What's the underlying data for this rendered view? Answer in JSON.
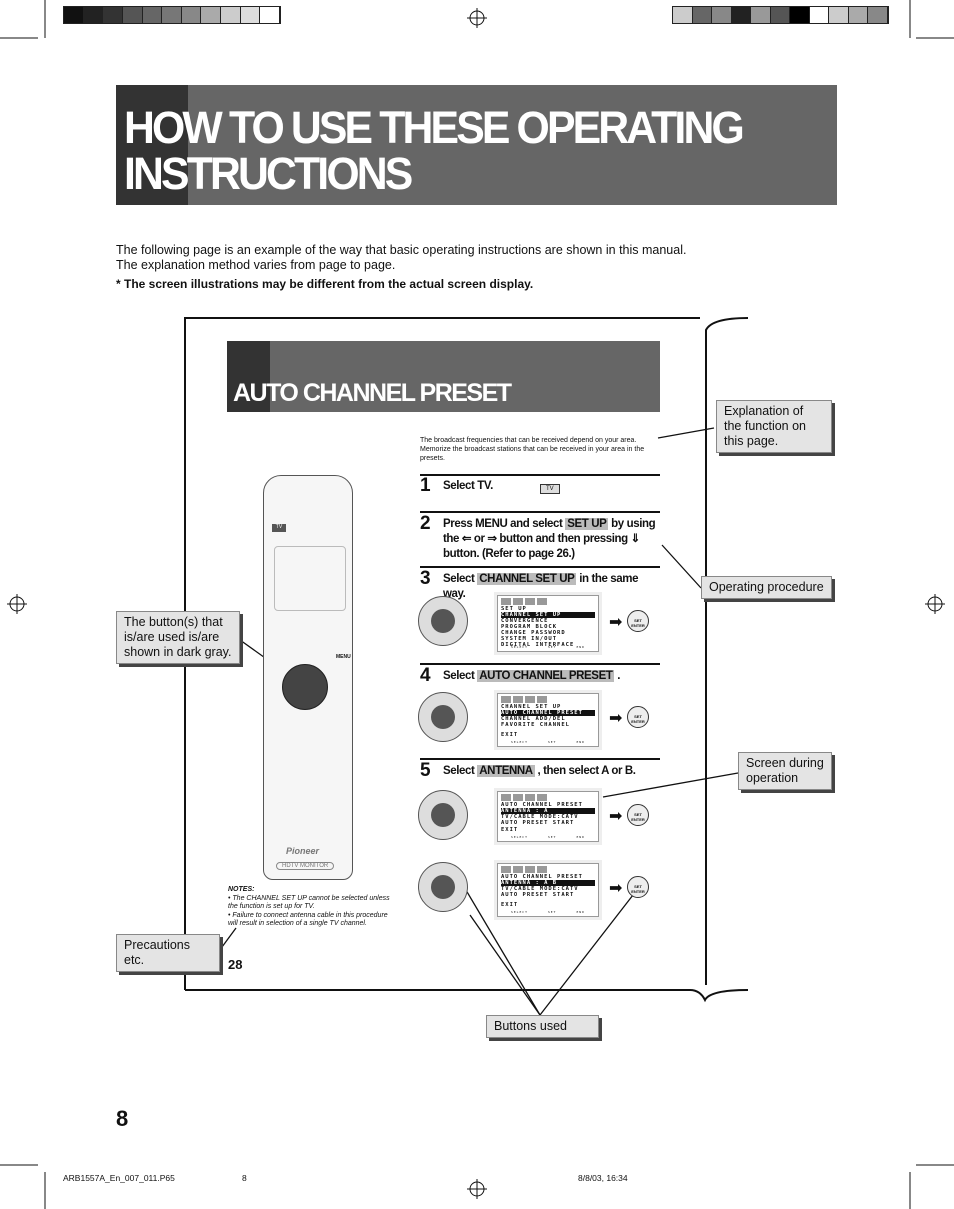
{
  "page": {
    "title": "HOW TO USE THESE OPERATING INSTRUCTIONS",
    "page_number": "8",
    "intro": [
      "The following page is an example of the way that basic operating instructions are shown in this manual.",
      "The explanation method varies from page to page."
    ],
    "note": "* The screen illustrations may be different from the actual screen display."
  },
  "example": {
    "title": "AUTO CHANNEL PRESET",
    "description": "The broadcast frequencies that can be received depend on your area. Memorize the broadcast stations that can be received in your area in the presets.",
    "steps": [
      {
        "num": "1",
        "text": "Select TV.",
        "button": "TV"
      },
      {
        "num": "2",
        "pre": "Press MENU and select ",
        "hl": "SET UP",
        "post": " by using the ⇐ or ⇒ button and then pressing ⇓ button. (Refer to page 26.)"
      },
      {
        "num": "3",
        "pre": "Select ",
        "hl": "CHANNEL SET UP",
        "post": " in the same way."
      },
      {
        "num": "4",
        "pre": "Select ",
        "hl": "AUTO CHANNEL PRESET",
        "post": " ."
      },
      {
        "num": "5",
        "pre": "Select ",
        "hl": "ANTENNA",
        "post": " , then select A or B."
      }
    ],
    "screens": [
      {
        "title": "SET UP",
        "items": [
          "CHANNEL SET UP",
          "CONVERGENCE",
          "PROGRAM BLOCK",
          "CHANGE PASSWORD",
          "SYSTEM IN/OUT",
          "DIGITAL INTERFACE"
        ],
        "selected": 0,
        "exit": ""
      },
      {
        "title": "CHANNEL SET UP",
        "items": [
          "AUTO CHANNEL PRESET",
          "CHANNEL ADD/DEL",
          "FAVORITE CHANNEL"
        ],
        "selected": 0,
        "exit": "EXIT"
      },
      {
        "title": "AUTO CHANNEL PRESET",
        "items": [
          "ANTENNA : A",
          "TV/CABLE MODE:CATV",
          "AUTO PRESET START"
        ],
        "selected": 0,
        "exit": "EXIT"
      },
      {
        "title": "AUTO CHANNEL PRESET",
        "items": [
          "ANTENNA : A B",
          "TV/CABLE MODE:CATV",
          "AUTO PRESET START"
        ],
        "selected": 0,
        "exit": "EXIT"
      }
    ],
    "screen_footer": [
      "SELECT",
      "SET",
      "END"
    ],
    "enter_label": "SET ENTER",
    "notes_title": "NOTES:",
    "notes": [
      "The CHANNEL SET UP cannot be selected unless the function is set up for TV.",
      "Failure to connect antenna cable in this procedure will result in selection of a single TV channel."
    ],
    "page_number": "28",
    "remote": {
      "brand": "Pioneer",
      "model": "HDTV MONITOR",
      "menu": "MENU",
      "tv": "TV"
    }
  },
  "callouts": {
    "explanation": "Explanation of the function on this page.",
    "procedure": "Operating procedure",
    "screen": "Screen during operation",
    "buttons_dark": "The button(s) that is/are used is/are shown in dark gray.",
    "precautions": "Precautions etc.",
    "buttons_used": "Buttons used"
  },
  "footer": {
    "file": "ARB1557A_En_007_011.P65",
    "page": "8",
    "date": "8/8/03, 16:34"
  },
  "colors": {
    "banner_dark": "#333333",
    "banner": "#666666",
    "callout": "#e4e4e4"
  }
}
